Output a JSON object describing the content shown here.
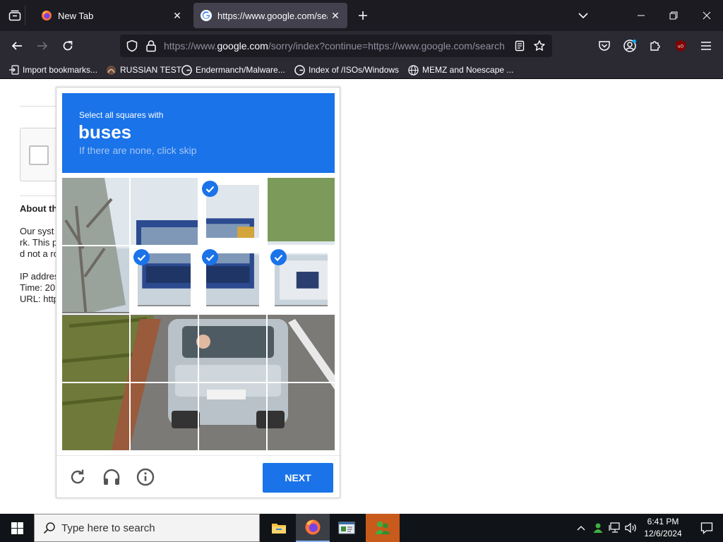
{
  "browser": {
    "tabs": [
      {
        "title": "New Tab",
        "icon": "firefox-icon",
        "active": false
      },
      {
        "title": "https://www.google.com/search",
        "icon": "google-icon",
        "active": true
      }
    ],
    "url": {
      "prefix": "https://www.",
      "domain": "google.com",
      "rest": "/sorry/index?continue=https://www.google.com/search"
    },
    "bookmarks": [
      {
        "label": "Import bookmarks...",
        "icon": "import-icon"
      },
      {
        "label": "RUSSIAN TEST",
        "icon": "bookmark-site-icon"
      },
      {
        "label": "Endermanch/Malware...",
        "icon": "google-icon"
      },
      {
        "label": "Index of /ISOs/Windows",
        "icon": "google-icon"
      },
      {
        "label": "MEMZ and Noescape ...",
        "icon": "globe-icon"
      }
    ]
  },
  "sorry_page": {
    "about_heading": "About th",
    "lines": [
      "Our syst",
      "rk. This p",
      "d not a ro",
      "IP addres",
      "Time: 20",
      "URL: http"
    ]
  },
  "captcha": {
    "instruction": "Select all squares with",
    "target": "buses",
    "hint": "If there are none, click skip",
    "selected_tiles": [
      2,
      5,
      6,
      7
    ],
    "next_label": "NEXT",
    "accent_color": "#1a73e8"
  },
  "taskbar": {
    "search_placeholder": "Type here to search",
    "time": "6:41 PM",
    "date": "12/6/2024"
  }
}
